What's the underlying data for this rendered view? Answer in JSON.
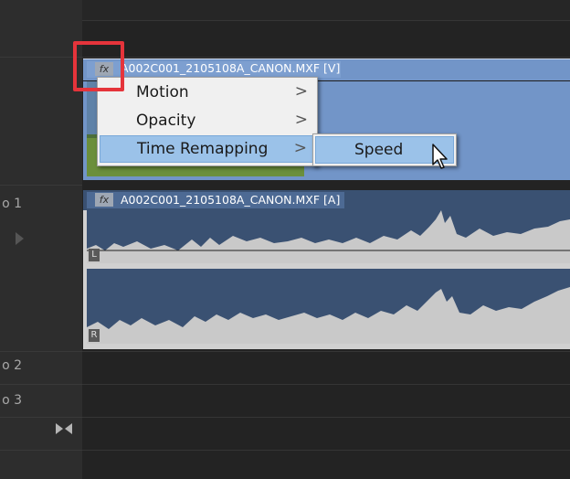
{
  "tracks": {
    "audio1_label": "o 1",
    "audio2_label": "o 2",
    "audio3_label": "o 3"
  },
  "video_clip": {
    "fx_label": "fx",
    "title": "A002C001_2105108A_CANON.MXF [V]"
  },
  "audio_clip": {
    "fx_label": "fx",
    "title": "A002C001_2105108A_CANON.MXF [A]",
    "left_channel": "L",
    "right_channel": "R"
  },
  "context_menu": {
    "items": [
      {
        "label": "Motion",
        "has_submenu": true
      },
      {
        "label": "Opacity",
        "has_submenu": true
      },
      {
        "label": "Time Remapping",
        "has_submenu": true,
        "active": true
      }
    ],
    "arrow_glyph": ">",
    "submenu": {
      "label": "Speed"
    }
  },
  "colors": {
    "video_clip": "#7295c8",
    "audio_clip": "#3a5172",
    "menu_highlight": "#9bc2e9",
    "callout": "#e5343b"
  }
}
